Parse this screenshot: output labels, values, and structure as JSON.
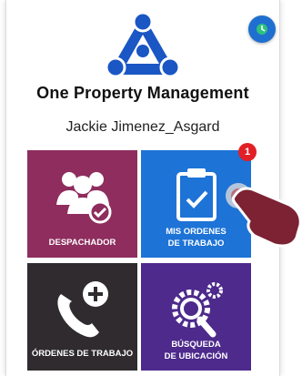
{
  "app": {
    "title": "One Property Management",
    "user_name": "Jackie Jimenez_Asgard"
  },
  "colors": {
    "accent_blue": "#1d73d6",
    "tile_despachador": "#8e2d5e",
    "tile_mis_ordenes": "#1d73d6",
    "tile_ordenes": "#2f2b2e",
    "tile_busqueda": "#4d2a8c",
    "badge_red": "#e21f26",
    "status_dot": "#1e6fd0"
  },
  "tiles": [
    {
      "label": "DESPACHADOR",
      "icon": "users-check-icon"
    },
    {
      "label_line1": "MIS ORDENES",
      "label_line2": "DE TRABAJO",
      "icon": "clipboard-check-icon",
      "badge": "1"
    },
    {
      "label": "ÓRDENES DE TRABAJO",
      "icon": "phone-plus-icon"
    },
    {
      "label_line1": "BÚSQUEDA",
      "label_line2": "DE UBICACIÓN",
      "icon": "gears-search-icon"
    }
  ]
}
